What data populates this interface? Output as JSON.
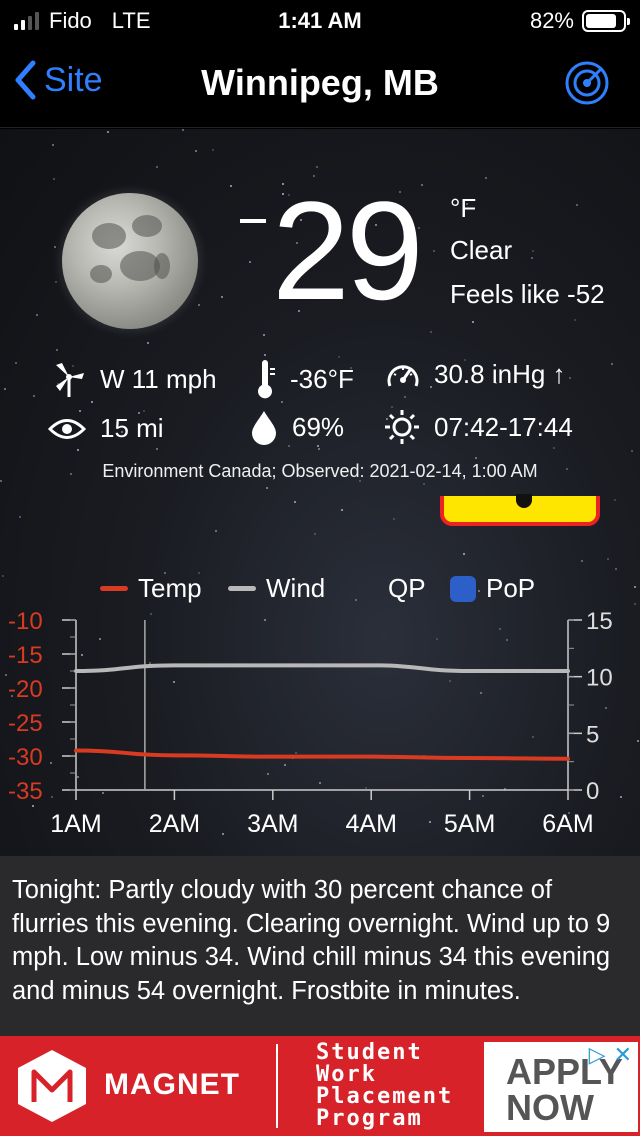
{
  "status_bar": {
    "carrier": "Fido",
    "network": "LTE",
    "time": "1:41 AM",
    "battery_percent": "82%",
    "battery_level": 0.82
  },
  "nav": {
    "back_label": "Site",
    "title": "Winnipeg, MB",
    "accent_color": "#2f80ff",
    "radar_icon": "radar-icon"
  },
  "current": {
    "temperature": "29",
    "unit": "°F",
    "condition": "Clear",
    "feels_like": "Feels like -52",
    "wind": "W 11 mph",
    "dew_point": "-36°F",
    "pressure": "30.8 inHg ↑",
    "visibility": "15 mi",
    "humidity": "69%",
    "sun": "07:42-17:44",
    "source": "Environment Canada; Observed: 2021-02-14, 1:00 AM"
  },
  "legend": {
    "temp": "Temp",
    "wind": "Wind",
    "qp": "QP",
    "pop": "PoP"
  },
  "chart_data": {
    "type": "line",
    "categories": [
      "1AM",
      "2AM",
      "3AM",
      "4AM",
      "5AM",
      "6AM"
    ],
    "series": [
      {
        "name": "Temp",
        "axis": "left",
        "color": "#d93a22",
        "values": [
          -29.2,
          -29.9,
          -30.1,
          -30.1,
          -30.3,
          -30.4
        ]
      },
      {
        "name": "Wind",
        "axis": "right",
        "color": "#b8b8b8",
        "values": [
          10.5,
          11,
          11,
          11,
          10.5,
          10.5
        ]
      }
    ],
    "left_axis": {
      "ticks": [
        "-10",
        "-15",
        "-20",
        "-25",
        "-30",
        "-35"
      ],
      "ylim": [
        -35,
        -10
      ],
      "color": "#d93a22"
    },
    "right_axis": {
      "ticks": [
        "15",
        "10",
        "5",
        "0"
      ],
      "ylim": [
        0,
        15
      ]
    },
    "now_marker_x": 1.7
  },
  "forecast": {
    "text": "Tonight:  Partly cloudy with 30 percent chance of flurries this evening. Clearing overnight. Wind up to 9 mph. Low minus 34. Wind chill minus 34 this evening and minus 54 overnight. Frostbite in minutes."
  },
  "ad": {
    "brand": "MAGNET",
    "program_lines": [
      "Student",
      "Work",
      "Placement",
      "Program"
    ],
    "cta_lines": [
      "APPLY",
      "NOW"
    ]
  }
}
